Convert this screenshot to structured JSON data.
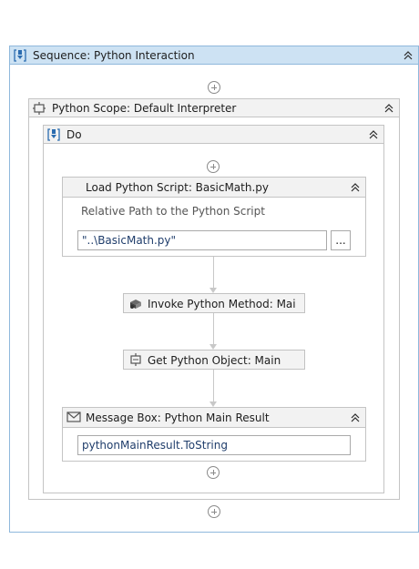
{
  "sequence": {
    "title": "Sequence: Python Interaction",
    "icon": "sequence-icon",
    "collapse_icon": "collapse-chevron-icon"
  },
  "scope": {
    "title": "Python Scope: Default Interpreter",
    "icon": "python-scope-icon"
  },
  "do": {
    "title": "Do",
    "icon": "sequence-icon"
  },
  "load": {
    "title": "Load Python Script: BasicMath.py",
    "field_label": "Relative Path to the Python Script",
    "field_value": "\"..\\BasicMath.py\"",
    "browse_label": "..."
  },
  "invoke": {
    "title": "Invoke Python Method: Mai",
    "icon": "invoke-method-icon"
  },
  "getobj": {
    "title": "Get Python Object: Main",
    "icon": "python-object-icon"
  },
  "msgbox": {
    "title": "Message Box: Python Main Result",
    "field_value": "pythonMainResult.ToString",
    "icon": "envelope-icon"
  },
  "colors": {
    "header_blue": "#cde2f3",
    "outer_border": "#6fa6d6",
    "panel_border": "#c4c4c4",
    "panel_header": "#f2f2f2",
    "text_blue": "#1f3d6b"
  }
}
